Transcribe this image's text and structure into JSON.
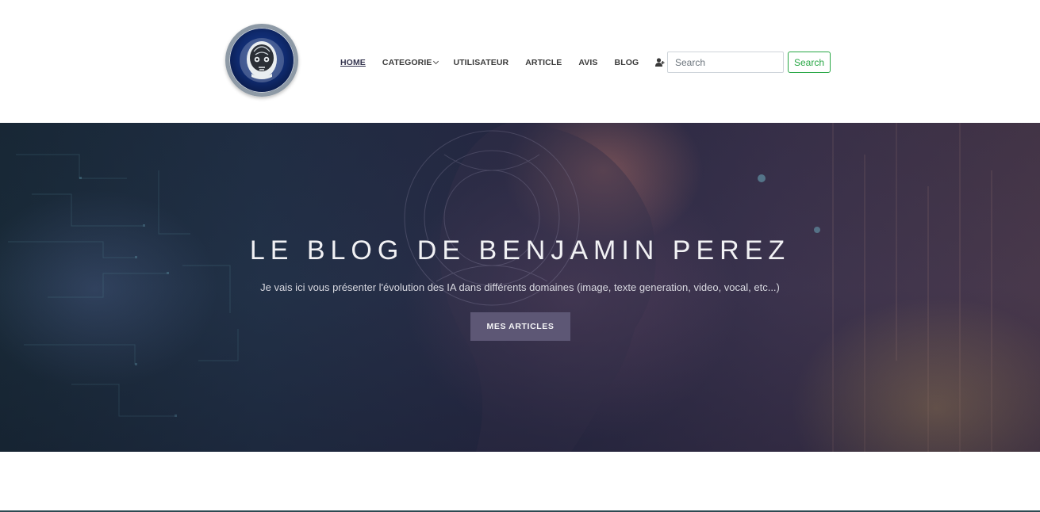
{
  "header": {
    "logo_icon": "robot-head-icon",
    "nav": {
      "home": "HOME",
      "categorie": "CATEGORIE",
      "utilisateur": "UTILISATEUR",
      "article": "ARTICLE",
      "avis": "AVIS",
      "blog": "BLOG",
      "register_icon": "user-plus-icon",
      "login_icon": "sign-in-icon"
    },
    "search": {
      "placeholder": "Search",
      "button_label": "Search"
    }
  },
  "hero": {
    "title": "LE BLOG DE BENJAMIN PEREZ",
    "subtitle": "Je vais ici vous présenter l'évolution des IA dans différents domaines (image, texte generation, video, vocal, etc...)",
    "button_label": "MES ARTICLES"
  },
  "colors": {
    "accent_green": "#28a745",
    "hero_button": "#5d5775"
  }
}
